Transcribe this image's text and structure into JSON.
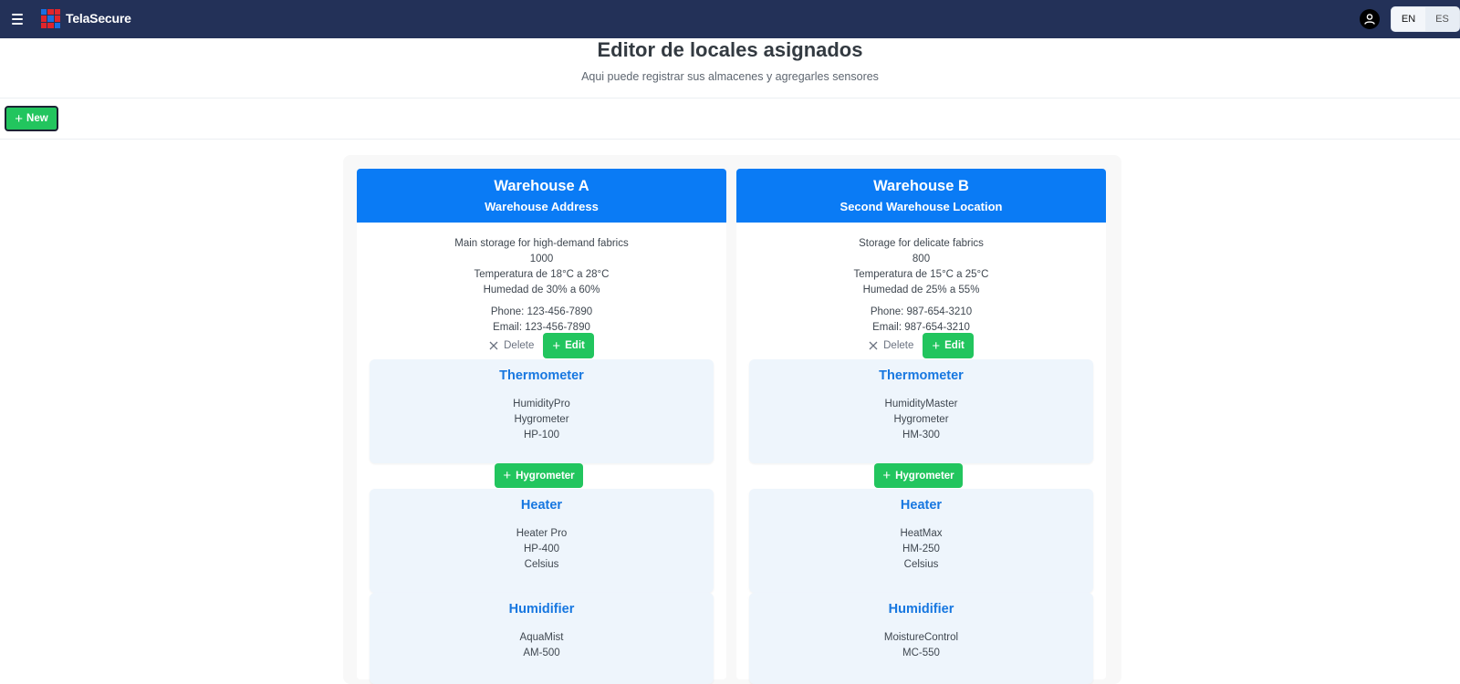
{
  "app": {
    "brand": "TelaSecure"
  },
  "lang": {
    "en": "EN",
    "es": "ES"
  },
  "header": {
    "title": "Editor de locales asignados",
    "subtitle": "Aqui puede registrar sus almacenes y agregarles sensores"
  },
  "toolbar": {
    "new_label": "New"
  },
  "colors": {
    "nav": "#233158",
    "accent_blue": "#0a7bf5",
    "green": "#22c55e",
    "device_bg": "#eef5fc"
  },
  "warehouses": [
    {
      "name": "Warehouse A",
      "address": "Warehouse Address",
      "description": "Main storage for high-demand fabrics",
      "capacity": "1000",
      "temperature": "Temperatura de 18°C a 28°C",
      "humidity": "Humedad de 30% a 60%",
      "phone": "Phone: 123-456-7890",
      "email": "Email: 123-456-7890",
      "delete_label": "Delete",
      "edit_label": "Edit",
      "hygrometer_label": "Hygrometer",
      "thermometer": {
        "title": "Thermometer",
        "lines": [
          "HumidityPro",
          "Hygrometer",
          "HP-100"
        ]
      },
      "heater": {
        "title": "Heater",
        "lines": [
          "Heater Pro",
          "HP-400",
          "Celsius"
        ]
      },
      "humidifier": {
        "title": "Humidifier",
        "lines": [
          "AquaMist",
          "AM-500"
        ]
      }
    },
    {
      "name": "Warehouse B",
      "address": "Second Warehouse Location",
      "description": "Storage for delicate fabrics",
      "capacity": "800",
      "temperature": "Temperatura de 15°C a 25°C",
      "humidity": "Humedad de 25% a 55%",
      "phone": "Phone: 987-654-3210",
      "email": "Email: 987-654-3210",
      "delete_label": "Delete",
      "edit_label": "Edit",
      "hygrometer_label": "Hygrometer",
      "thermometer": {
        "title": "Thermometer",
        "lines": [
          "HumidityMaster",
          "Hygrometer",
          "HM-300"
        ]
      },
      "heater": {
        "title": "Heater",
        "lines": [
          "HeatMax",
          "HM-250",
          "Celsius"
        ]
      },
      "humidifier": {
        "title": "Humidifier",
        "lines": [
          "MoistureControl",
          "MC-550"
        ]
      }
    }
  ]
}
